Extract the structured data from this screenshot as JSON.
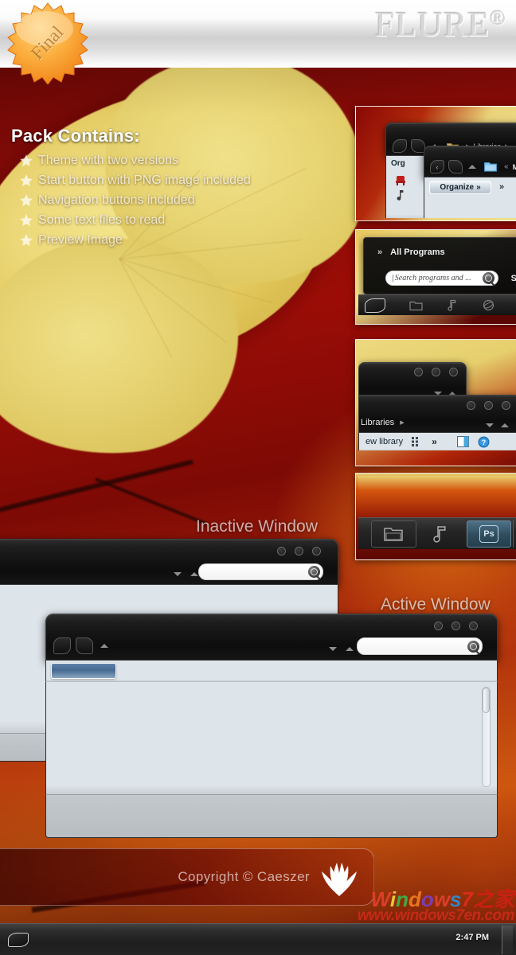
{
  "header": {
    "brand": "FLURE",
    "brand_mark": "®",
    "badge_label": "Final"
  },
  "pack": {
    "title": "Pack Contains:",
    "items": [
      "Theme with two versions",
      "Start button with PNG image included",
      "Navigation buttons included",
      "Some text files to read",
      "Preview Image"
    ],
    "bullet_icon": "star-icon"
  },
  "previews": {
    "explorer_pair": {
      "back_icon": "back-arrow-icon",
      "forward_icon": "forward-arrow-icon",
      "dropdown_icon": "chevron-down-icon",
      "folder_icon": "folder-icon",
      "crumb_libraries": "Libraries",
      "crumb_sep": "▸",
      "crumb_my": "My ",
      "crumb_back_chevrons": "«",
      "organize_partial": "Org",
      "organize_label": "Organize",
      "organize_chevrons": "»",
      "toolbar_chevrons": "»",
      "sidebar_icon_1": "red-chair-icon",
      "sidebar_icon_2": "music-note-icon"
    },
    "start_menu": {
      "all_programs_chevrons": "»",
      "all_programs_label": "All Programs",
      "search_placeholder": "Search programs and ...",
      "search_icon": "search-icon",
      "shutdown_partial": "S",
      "taskbar_icons": [
        "start-orb-icon",
        "explorer-icon",
        "media-player-icon",
        "internet-explorer-icon"
      ]
    },
    "libraries_pair": {
      "crumb_libraries": "Libraries",
      "crumb_sep": "▸",
      "new_library_partial": "ew library",
      "view_icon": "view-layout-icon",
      "chevrons": "»",
      "preview_pane_icon": "preview-pane-icon",
      "help_icon": "help-icon"
    },
    "taskbar_strip": {
      "icons": [
        "explorer-icon",
        "media-player-icon",
        "photoshop-icon"
      ],
      "photoshop_label": "Ps",
      "active_index": 2
    }
  },
  "desktop": {
    "inactive_window": {
      "label": "Inactive Window",
      "dropdown_icon": "chevron-down-icon",
      "dropup_icon": "chevron-up-icon",
      "search_icon": "search-icon",
      "search_value": "",
      "minimize_icon": "minimize-icon",
      "maximize_icon": "maximize-icon",
      "close_icon": "close-icon"
    },
    "active_window": {
      "label": "Active Window",
      "back_icon": "back-arrow-icon",
      "forward_icon": "forward-arrow-icon",
      "dropup_icon": "chevron-up-icon",
      "dropdown_icon": "chevron-down-icon",
      "search_icon": "search-icon",
      "search_value": "",
      "minimize_icon": "minimize-icon",
      "maximize_icon": "maximize-icon",
      "close_icon": "close-icon",
      "selected_tab": "",
      "scrollbar": "vertical-scrollbar"
    }
  },
  "footer": {
    "copyright": "Copyright © Caeszer",
    "logo_icon": "leaf-wing-logo"
  },
  "taskbar": {
    "start_icon": "start-orb-icon",
    "clock": "2:47 PM",
    "show_desktop_icon": "show-desktop-button"
  },
  "watermark": {
    "line1_chars": [
      "W",
      "i",
      "n",
      "d",
      "o",
      "w",
      "s",
      "7"
    ],
    "line1_cjk": "之家",
    "line2": "www.windows7en.com"
  },
  "colors": {
    "accent_orange": "#f08020",
    "brand_gray": "#d9d9d9",
    "window_dark": "#141414",
    "pane_blue": "#dde4ea",
    "watermark_red": "#d42c1c"
  }
}
